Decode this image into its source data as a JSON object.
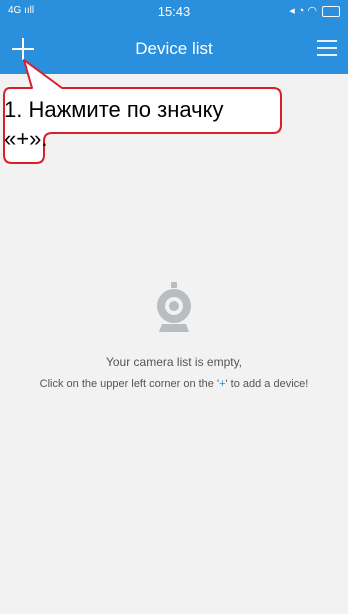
{
  "statusbar": {
    "signal": "4G ııll",
    "time": "15:43"
  },
  "header": {
    "title": "Device list",
    "add_icon": "plus-icon",
    "menu_icon": "hamburger-menu-icon"
  },
  "callout": {
    "line1": "1. Нажмите по значку",
    "line2": "«+»."
  },
  "empty": {
    "icon": "camera-icon",
    "line1": "Your camera list is empty,",
    "line2_prefix": "Click on the upper left corner on the '",
    "line2_plus": "+",
    "line2_suffix": "' to add a device!"
  },
  "colors": {
    "header": "#2a8fdc",
    "callout_border": "#d8202c",
    "background": "#f2f2f2"
  }
}
